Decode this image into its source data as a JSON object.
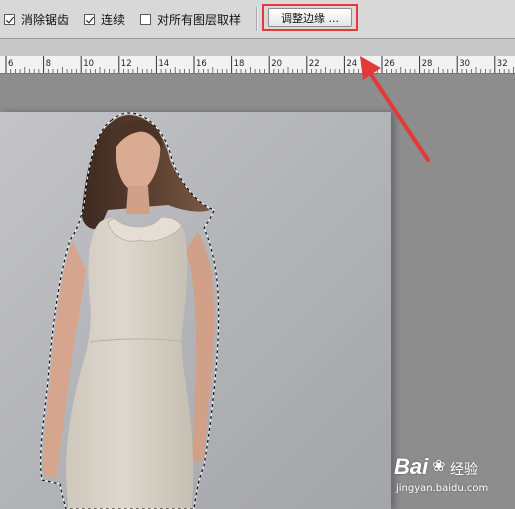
{
  "options_bar": {
    "anti_alias": {
      "label": "消除锯齿",
      "checked": true
    },
    "contiguous": {
      "label": "连续",
      "checked": true
    },
    "sample_all_layers": {
      "label": "对所有图层取样",
      "checked": false
    },
    "refine_edge_button": "调整边缘 ..."
  },
  "ruler": {
    "labels": [
      "6",
      "8",
      "10",
      "12",
      "14",
      "16",
      "18",
      "20",
      "22",
      "24",
      "26",
      "28",
      "30",
      "32"
    ]
  },
  "annotation": {
    "color": "#e23a3a"
  },
  "watermark": {
    "logo": "Bai",
    "sub": "经验",
    "url": "jingyan.baidu.com"
  }
}
